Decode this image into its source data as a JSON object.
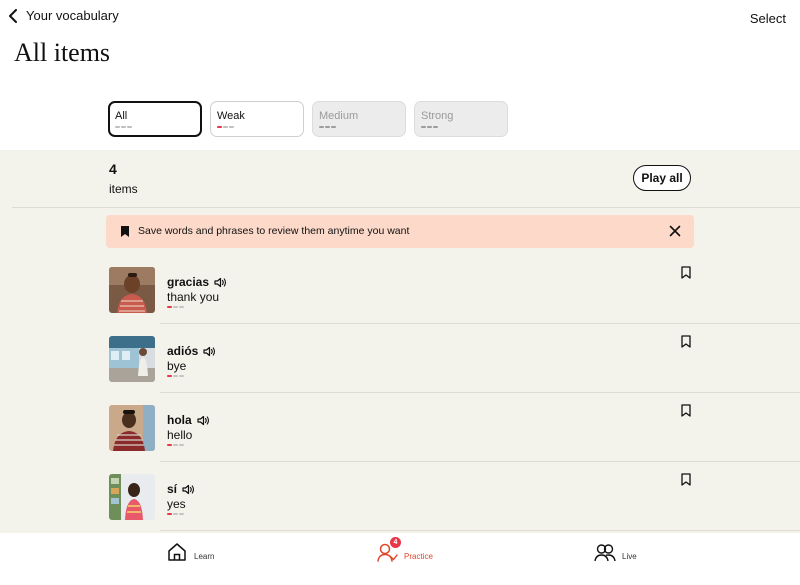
{
  "header": {
    "back_label": "Your vocabulary",
    "select_label": "Select",
    "title": "All items"
  },
  "filters": [
    {
      "label": "All",
      "state": "active"
    },
    {
      "label": "Weak",
      "state": "enabled"
    },
    {
      "label": "Medium",
      "state": "disabled"
    },
    {
      "label": "Strong",
      "state": "disabled"
    }
  ],
  "summary": {
    "count": "4",
    "count_label": "items",
    "play_all_label": "Play all"
  },
  "banner": {
    "text": "Save words and phrases to review them anytime you want"
  },
  "items": [
    {
      "word": "gracias",
      "translation": "thank you",
      "strength": "weak"
    },
    {
      "word": "adiós",
      "translation": "bye",
      "strength": "weak"
    },
    {
      "word": "hola",
      "translation": "hello",
      "strength": "weak"
    },
    {
      "word": "sí",
      "translation": "yes",
      "strength": "weak"
    }
  ],
  "bottom_nav": {
    "learn_label": "Learn",
    "practice_label": "Practice",
    "practice_badge": "4",
    "live_label": "Live"
  },
  "colors": {
    "accent": "#e8364a",
    "practice_active": "#e0462a",
    "panel_bg": "#f3f2eb",
    "banner_bg": "#fcd9c9"
  },
  "icons": [
    "chevron-left-icon",
    "bookmark-icon",
    "close-icon",
    "speaker-icon",
    "home-icon",
    "practice-icon",
    "live-icon"
  ]
}
